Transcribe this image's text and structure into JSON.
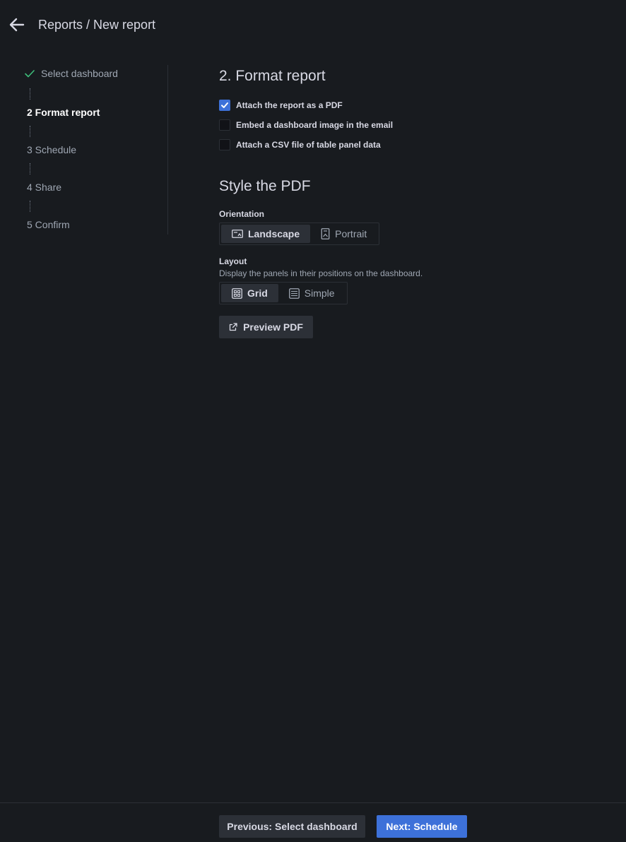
{
  "header": {
    "breadcrumb": "Reports / New report"
  },
  "stepper": {
    "steps": [
      {
        "label": "Select dashboard",
        "state": "done"
      },
      {
        "label": "2 Format report",
        "state": "active"
      },
      {
        "label": "3 Schedule",
        "state": "pending"
      },
      {
        "label": "4 Share",
        "state": "pending"
      },
      {
        "label": "5 Confirm",
        "state": "pending"
      }
    ]
  },
  "format": {
    "title": "2. Format report",
    "options": [
      {
        "label": "Attach the report as a PDF",
        "checked": true
      },
      {
        "label": "Embed a dashboard image in the email",
        "checked": false
      },
      {
        "label": "Attach a CSV file of table panel data",
        "checked": false
      }
    ]
  },
  "style": {
    "title": "Style the PDF",
    "orientation": {
      "label": "Orientation",
      "options": [
        "Landscape",
        "Portrait"
      ],
      "selected": "Landscape"
    },
    "layout": {
      "label": "Layout",
      "description": "Display the panels in their positions on the dashboard.",
      "options": [
        "Grid",
        "Simple"
      ],
      "selected": "Grid"
    },
    "preview_label": "Preview PDF"
  },
  "footer": {
    "prev_label": "Previous: Select dashboard",
    "next_label": "Next: Schedule"
  },
  "colors": {
    "background": "#181b1f",
    "primary": "#3d71d9",
    "success": "#3ebd7a",
    "secondary_button": "#2c3037"
  },
  "icons": {
    "back": "arrow-left-icon",
    "done": "check-icon",
    "landscape": "landscape-icon",
    "portrait": "portrait-icon",
    "grid": "grid-layout-icon",
    "simple": "simple-layout-icon",
    "preview": "external-link-icon"
  }
}
